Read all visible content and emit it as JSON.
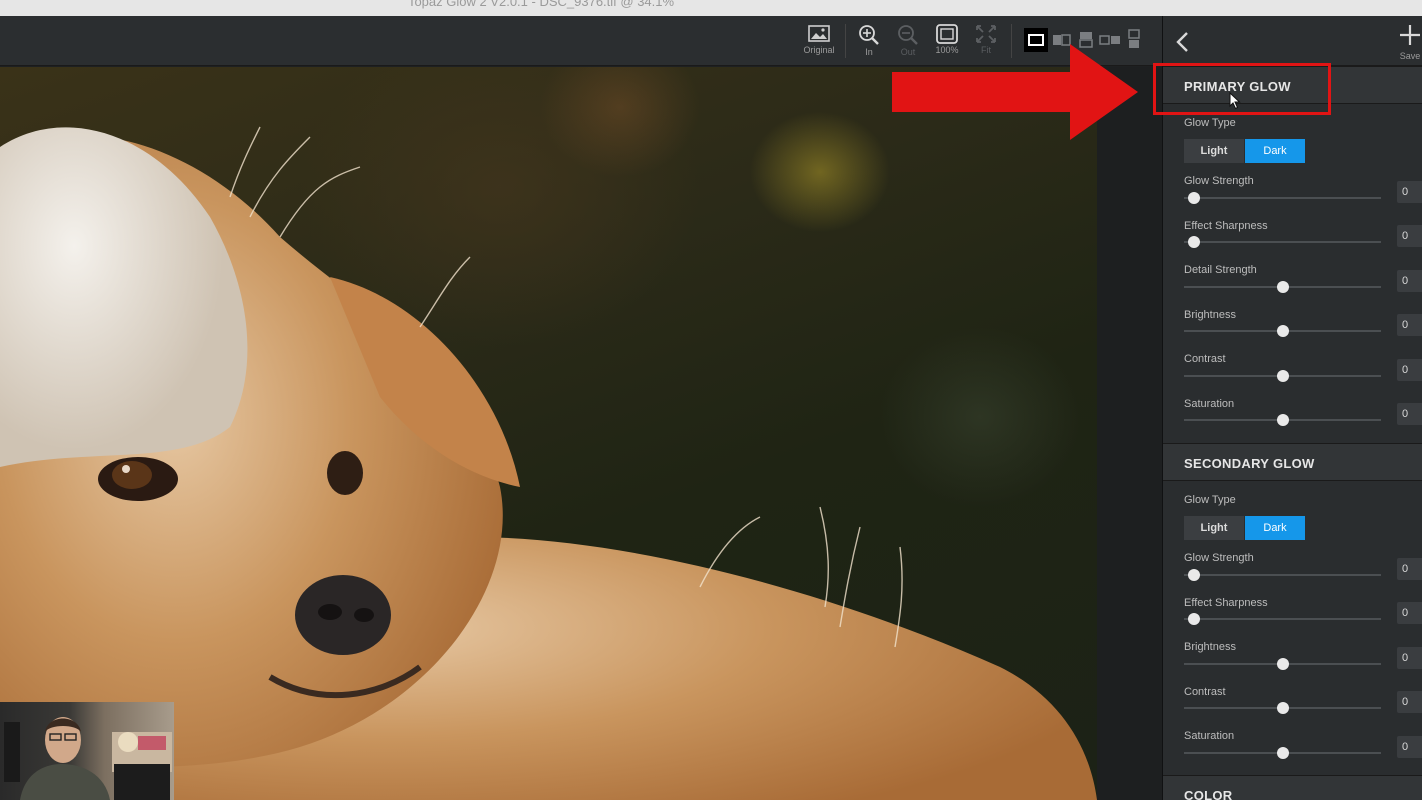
{
  "window": {
    "title": "Topaz Glow 2 V2.0.1 - DSC_9376.tif @ 34.1%"
  },
  "toolbar": {
    "original_label": "Original",
    "zoom_in_label": "In",
    "zoom_out_label": "Out",
    "zoom_100_label": "100%",
    "fit_label": "Fit",
    "save_label": "Save"
  },
  "primary_glow": {
    "title": "PRIMARY GLOW",
    "glow_type_label": "Glow Type",
    "glow_type_options": [
      "Light",
      "Dark"
    ],
    "glow_type_selected": "Dark",
    "sliders": [
      {
        "label": "Glow Strength",
        "position": 0.05,
        "value": "0"
      },
      {
        "label": "Effect Sharpness",
        "position": 0.05,
        "value": "0"
      },
      {
        "label": "Detail Strength",
        "position": 0.5,
        "value": "0"
      },
      {
        "label": "Brightness",
        "position": 0.5,
        "value": "0"
      },
      {
        "label": "Contrast",
        "position": 0.5,
        "value": "0"
      },
      {
        "label": "Saturation",
        "position": 0.5,
        "value": "0"
      }
    ]
  },
  "secondary_glow": {
    "title": "SECONDARY GLOW",
    "glow_type_label": "Glow Type",
    "glow_type_options": [
      "Light",
      "Dark"
    ],
    "glow_type_selected": "Dark",
    "sliders": [
      {
        "label": "Glow Strength",
        "position": 0.05,
        "value": "0"
      },
      {
        "label": "Effect Sharpness",
        "position": 0.05,
        "value": "0"
      },
      {
        "label": "Brightness",
        "position": 0.5,
        "value": "0"
      },
      {
        "label": "Contrast",
        "position": 0.5,
        "value": "0"
      },
      {
        "label": "Saturation",
        "position": 0.5,
        "value": "0"
      }
    ]
  },
  "color_section": {
    "title": "COLOR"
  },
  "colors": {
    "accent": "#1597ea",
    "annotation": "#e11414"
  },
  "icons": {
    "original": "image-icon",
    "zoom_in": "zoom-in-icon",
    "zoom_out": "zoom-out-icon",
    "zoom_100": "actual-size-icon",
    "fit": "fit-screen-icon",
    "back": "chevron-left-icon",
    "save": "plus-icon"
  }
}
